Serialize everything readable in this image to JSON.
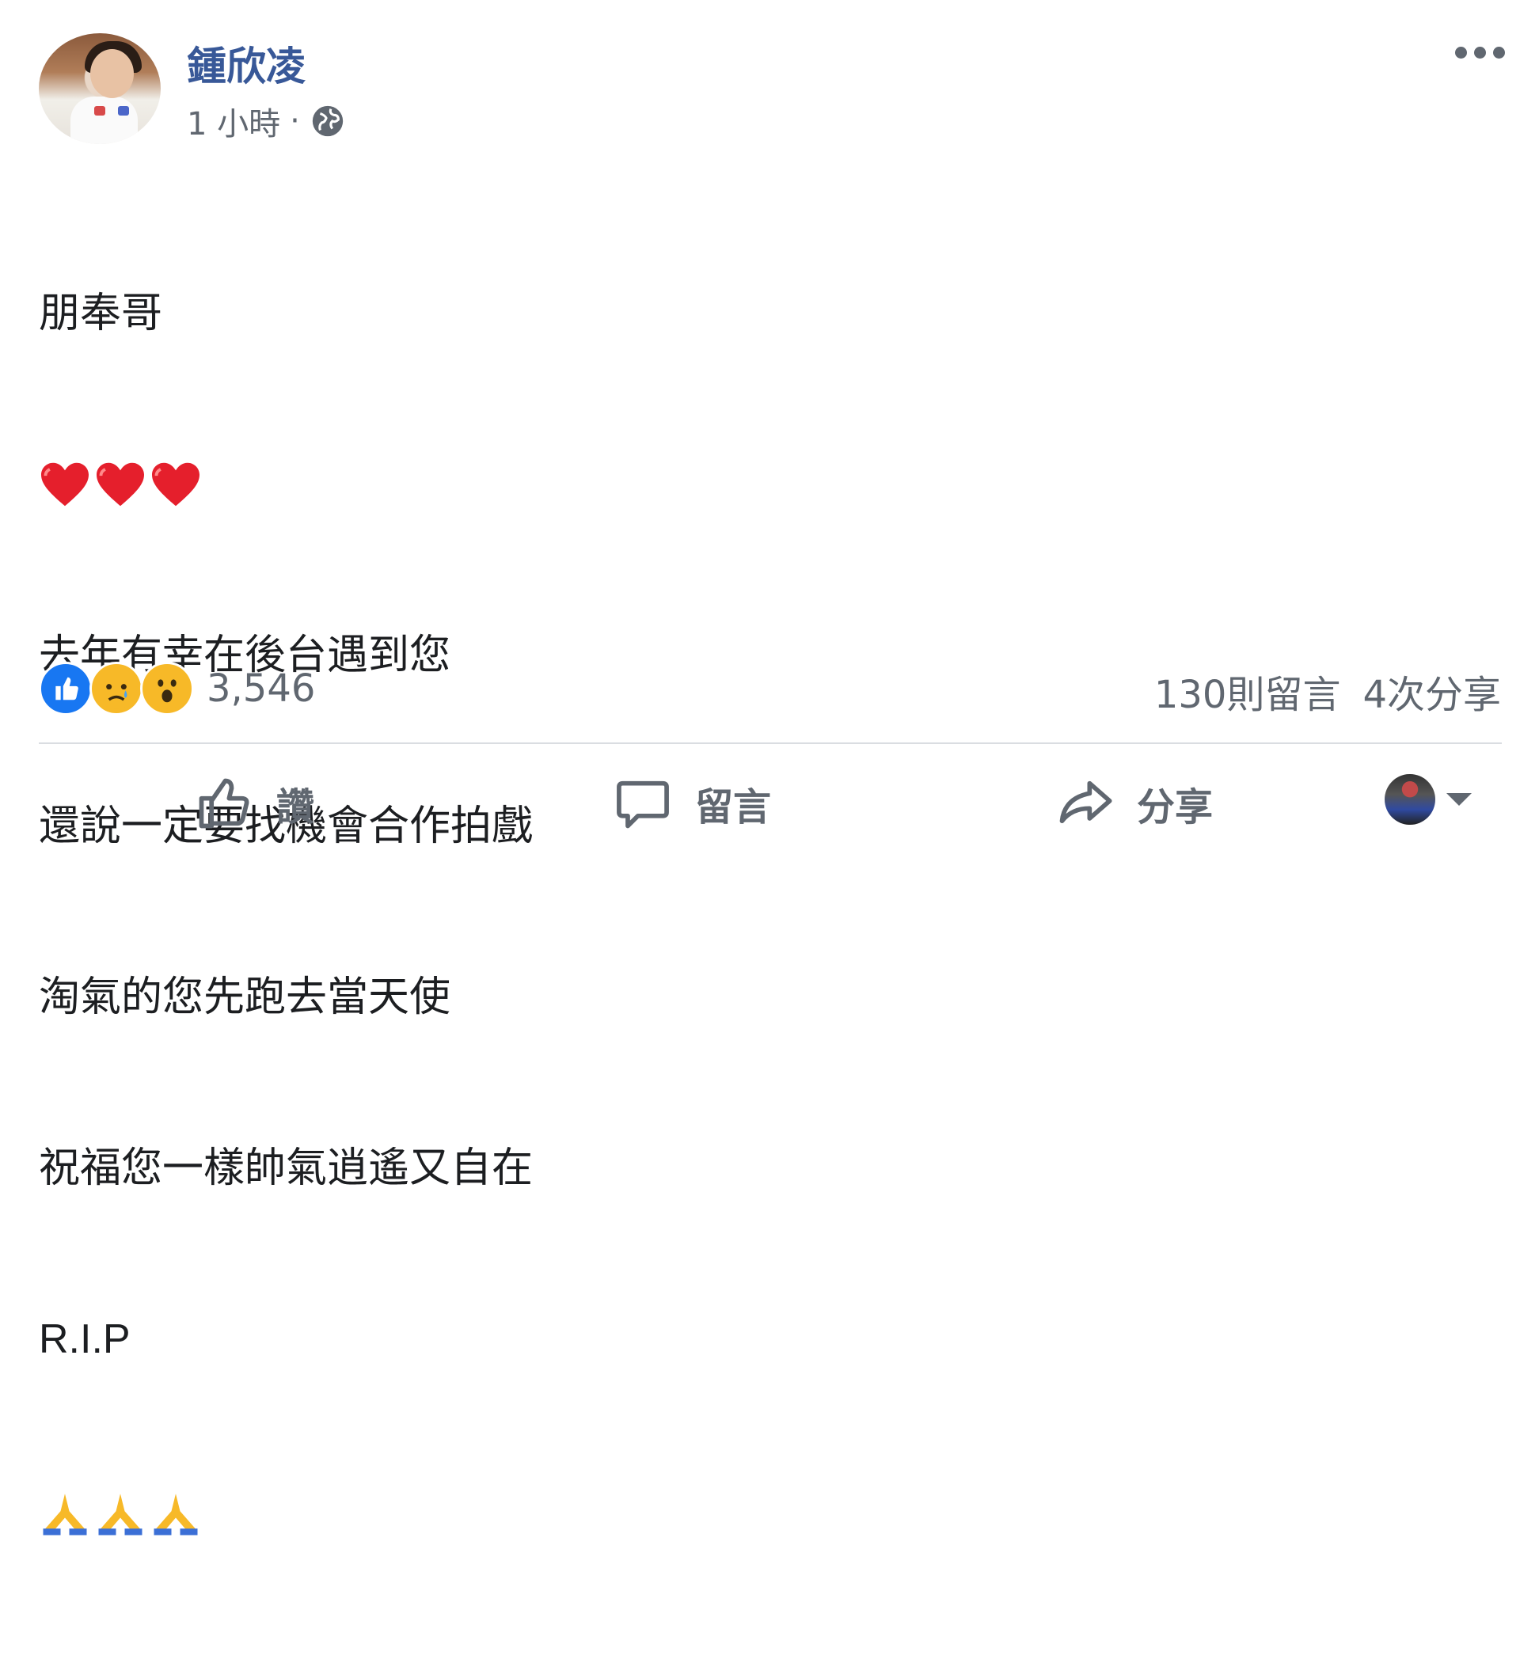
{
  "post": {
    "author": "鍾欣凌",
    "time": "1 小時",
    "separator": "·",
    "privacy_icon": "globe-icon",
    "more_icon": "more-icon",
    "lines": [
      "朋奉哥",
      "去年有幸在後台遇到您",
      "還說一定要找機會合作拍戲",
      "淘氣的您先跑去當天使",
      "祝福您一樣帥氣逍遙又自在",
      "R.I.P"
    ],
    "heart_emoji": "❤",
    "pray_emoji": "🙏"
  },
  "reactions": {
    "icons": [
      "like-icon",
      "sad-icon",
      "wow-icon"
    ],
    "count": "3,546"
  },
  "stats": {
    "comments": "130則留言",
    "shares": "4次分享"
  },
  "actions": {
    "like_label": "讚",
    "comment_label": "留言",
    "share_label": "分享"
  },
  "colors": {
    "author": "#385898",
    "meta": "#606770",
    "like_blue": "#1877f2",
    "reaction_yellow": "#f7b928",
    "heart_red": "#e0245e"
  }
}
